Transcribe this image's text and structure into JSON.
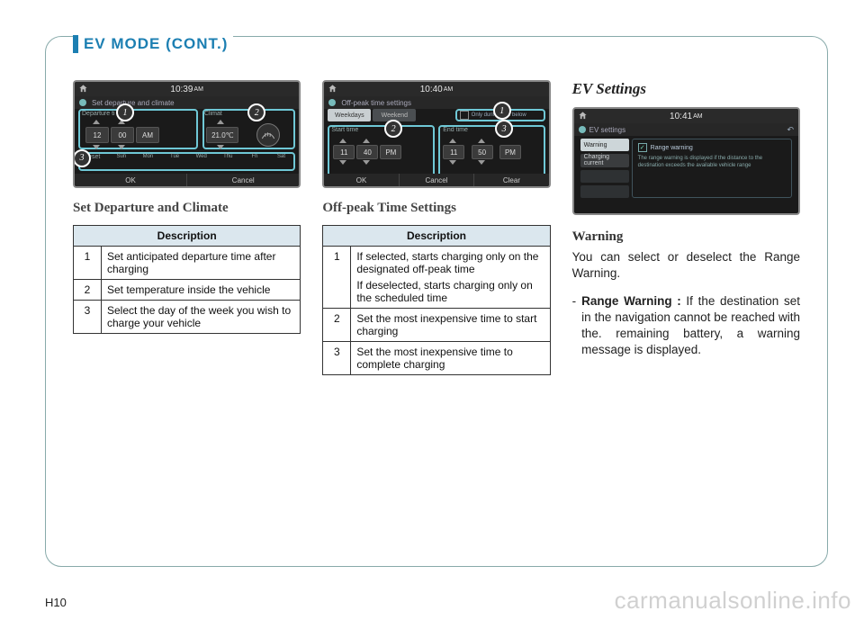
{
  "header": {
    "title": "EV MODE (CONT.)"
  },
  "page_number": "H10",
  "watermark": "carmanualsonline.info",
  "col1": {
    "screen": {
      "time": "10:39",
      "ampm": "AM",
      "title": "Set departure and climate",
      "panel_departure_label": "Departure ti",
      "panel_climate_label": "Climat",
      "hour": "12",
      "minute": "00",
      "hm_ampm": "AM",
      "temp": "21.0℃",
      "days_label": "Reset",
      "days": [
        "Sun",
        "Mon",
        "Tue",
        "Wed",
        "Thu",
        "Fri",
        "Sat"
      ],
      "bottom": [
        "OK",
        "Cancel"
      ]
    },
    "subtitle": "Set Departure and Climate",
    "table": {
      "header": "Description",
      "rows": [
        {
          "idx": "1",
          "text": "Set anticipated departure time after charging"
        },
        {
          "idx": "2",
          "text": "Set temperature inside the vehicle"
        },
        {
          "idx": "3",
          "text": "Select the day of the week you wish to charge your vehicle"
        }
      ]
    }
  },
  "col2": {
    "screen": {
      "time": "10:40",
      "ampm": "AM",
      "title": "Off-peak time settings",
      "tab_weekdays": "Weekdays",
      "tab_weekend": "Weekend",
      "checkbox_label": "Only during time below",
      "start_label": "Start time",
      "end_label": "End time",
      "start_h": "11",
      "start_m": "40",
      "start_ampm": "PM",
      "end_h": "11",
      "end_m": "50",
      "end_ampm": "PM",
      "bottom": [
        "OK",
        "Cancel",
        "Clear"
      ]
    },
    "subtitle": "Off-peak Time Settings",
    "table": {
      "header": "Description",
      "rows": [
        {
          "idx": "1",
          "text_a": "If selected, starts charging only on the designated off-peak time",
          "text_b": "If deselected, starts charging only on the scheduled time"
        },
        {
          "idx": "2",
          "text": "Set the most inexpensive time to start charging"
        },
        {
          "idx": "3",
          "text": "Set the most inexpensive time to complete charging"
        }
      ]
    }
  },
  "col3": {
    "title": "EV Settings",
    "screen": {
      "time": "10:41",
      "ampm": "AM",
      "title": "EV settings",
      "side_warning": "Warning",
      "side_charging": "Charging current",
      "option_label": "Range warning",
      "option_desc": "The range warning is displayed if the distance to the destination exceeds the available vehicle range"
    },
    "warning_head": "Warning",
    "intro": "You can select or deselect  the Range Warning.",
    "bullet_label": "Range Warning :",
    "bullet_text": " If the destination set in the navigation cannot be reached with the. remaining battery, a warning message is displayed."
  }
}
